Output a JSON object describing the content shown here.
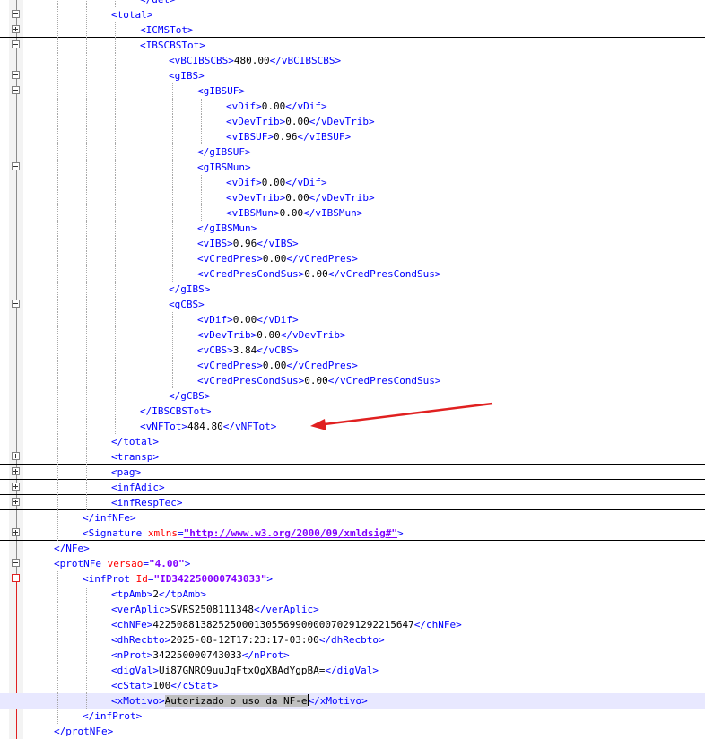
{
  "editor": {
    "colors": {
      "tag": "#0000ff",
      "attribute": "#ff0000",
      "attribute_value": "#8000ff",
      "text": "#000000",
      "annotation_arrow": "#e02020"
    },
    "annotation": {
      "type": "red-arrow",
      "points_to": "vNFTot"
    },
    "lines": [
      {
        "depth": 4,
        "fold": "none",
        "parts": [
          {
            "k": "t",
            "s": "</det>"
          }
        ]
      },
      {
        "depth": 3,
        "fold": "minus",
        "parts": [
          {
            "k": "t",
            "s": "<total>"
          }
        ]
      },
      {
        "depth": 4,
        "fold": "plus",
        "parts": [
          {
            "k": "t",
            "s": "<ICMSTot>"
          }
        ],
        "separator": true
      },
      {
        "depth": 4,
        "fold": "minus",
        "parts": [
          {
            "k": "t",
            "s": "<IBSCBSTot>"
          }
        ]
      },
      {
        "depth": 5,
        "fold": "none",
        "parts": [
          {
            "k": "t",
            "s": "<vBCIBSCBS>"
          },
          {
            "k": "x",
            "s": "480.00"
          },
          {
            "k": "t",
            "s": "</vBCIBSCBS>"
          }
        ]
      },
      {
        "depth": 5,
        "fold": "minus",
        "parts": [
          {
            "k": "t",
            "s": "<gIBS>"
          }
        ]
      },
      {
        "depth": 6,
        "fold": "minus",
        "parts": [
          {
            "k": "t",
            "s": "<gIBSUF>"
          }
        ]
      },
      {
        "depth": 7,
        "fold": "none",
        "parts": [
          {
            "k": "t",
            "s": "<vDif>"
          },
          {
            "k": "x",
            "s": "0.00"
          },
          {
            "k": "t",
            "s": "</vDif>"
          }
        ]
      },
      {
        "depth": 7,
        "fold": "none",
        "parts": [
          {
            "k": "t",
            "s": "<vDevTrib>"
          },
          {
            "k": "x",
            "s": "0.00"
          },
          {
            "k": "t",
            "s": "</vDevTrib>"
          }
        ]
      },
      {
        "depth": 7,
        "fold": "none",
        "parts": [
          {
            "k": "t",
            "s": "<vIBSUF>"
          },
          {
            "k": "x",
            "s": "0.96"
          },
          {
            "k": "t",
            "s": "</vIBSUF>"
          }
        ]
      },
      {
        "depth": 6,
        "fold": "none",
        "parts": [
          {
            "k": "t",
            "s": "</gIBSUF>"
          }
        ]
      },
      {
        "depth": 6,
        "fold": "minus",
        "parts": [
          {
            "k": "t",
            "s": "<gIBSMun>"
          }
        ]
      },
      {
        "depth": 7,
        "fold": "none",
        "parts": [
          {
            "k": "t",
            "s": "<vDif>"
          },
          {
            "k": "x",
            "s": "0.00"
          },
          {
            "k": "t",
            "s": "</vDif>"
          }
        ]
      },
      {
        "depth": 7,
        "fold": "none",
        "parts": [
          {
            "k": "t",
            "s": "<vDevTrib>"
          },
          {
            "k": "x",
            "s": "0.00"
          },
          {
            "k": "t",
            "s": "</vDevTrib>"
          }
        ]
      },
      {
        "depth": 7,
        "fold": "none",
        "parts": [
          {
            "k": "t",
            "s": "<vIBSMun>"
          },
          {
            "k": "x",
            "s": "0.00"
          },
          {
            "k": "t",
            "s": "</vIBSMun>"
          }
        ]
      },
      {
        "depth": 6,
        "fold": "none",
        "parts": [
          {
            "k": "t",
            "s": "</gIBSMun>"
          }
        ]
      },
      {
        "depth": 6,
        "fold": "none",
        "parts": [
          {
            "k": "t",
            "s": "<vIBS>"
          },
          {
            "k": "x",
            "s": "0.96"
          },
          {
            "k": "t",
            "s": "</vIBS>"
          }
        ]
      },
      {
        "depth": 6,
        "fold": "none",
        "parts": [
          {
            "k": "t",
            "s": "<vCredPres>"
          },
          {
            "k": "x",
            "s": "0.00"
          },
          {
            "k": "t",
            "s": "</vCredPres>"
          }
        ]
      },
      {
        "depth": 6,
        "fold": "none",
        "parts": [
          {
            "k": "t",
            "s": "<vCredPresCondSus>"
          },
          {
            "k": "x",
            "s": "0.00"
          },
          {
            "k": "t",
            "s": "</vCredPresCondSus>"
          }
        ]
      },
      {
        "depth": 5,
        "fold": "none",
        "parts": [
          {
            "k": "t",
            "s": "</gIBS>"
          }
        ]
      },
      {
        "depth": 5,
        "fold": "minus",
        "parts": [
          {
            "k": "t",
            "s": "<gCBS>"
          }
        ]
      },
      {
        "depth": 6,
        "fold": "none",
        "parts": [
          {
            "k": "t",
            "s": "<vDif>"
          },
          {
            "k": "x",
            "s": "0.00"
          },
          {
            "k": "t",
            "s": "</vDif>"
          }
        ]
      },
      {
        "depth": 6,
        "fold": "none",
        "parts": [
          {
            "k": "t",
            "s": "<vDevTrib>"
          },
          {
            "k": "x",
            "s": "0.00"
          },
          {
            "k": "t",
            "s": "</vDevTrib>"
          }
        ]
      },
      {
        "depth": 6,
        "fold": "none",
        "parts": [
          {
            "k": "t",
            "s": "<vCBS>"
          },
          {
            "k": "x",
            "s": "3.84"
          },
          {
            "k": "t",
            "s": "</vCBS>"
          }
        ]
      },
      {
        "depth": 6,
        "fold": "none",
        "parts": [
          {
            "k": "t",
            "s": "<vCredPres>"
          },
          {
            "k": "x",
            "s": "0.00"
          },
          {
            "k": "t",
            "s": "</vCredPres>"
          }
        ]
      },
      {
        "depth": 6,
        "fold": "none",
        "parts": [
          {
            "k": "t",
            "s": "<vCredPresCondSus>"
          },
          {
            "k": "x",
            "s": "0.00"
          },
          {
            "k": "t",
            "s": "</vCredPresCondSus>"
          }
        ]
      },
      {
        "depth": 5,
        "fold": "none",
        "parts": [
          {
            "k": "t",
            "s": "</gCBS>"
          }
        ]
      },
      {
        "depth": 4,
        "fold": "none",
        "parts": [
          {
            "k": "t",
            "s": "</IBSCBSTot>"
          }
        ]
      },
      {
        "depth": 4,
        "fold": "none",
        "arrow_target": true,
        "parts": [
          {
            "k": "t",
            "s": "<vNFTot>"
          },
          {
            "k": "x",
            "s": "484.80"
          },
          {
            "k": "t",
            "s": "</vNFTot>"
          }
        ]
      },
      {
        "depth": 3,
        "fold": "none",
        "parts": [
          {
            "k": "t",
            "s": "</total>"
          }
        ]
      },
      {
        "depth": 3,
        "fold": "plus",
        "parts": [
          {
            "k": "t",
            "s": "<transp>"
          }
        ],
        "separator": true
      },
      {
        "depth": 3,
        "fold": "plus",
        "parts": [
          {
            "k": "t",
            "s": "<pag>"
          }
        ],
        "separator": true
      },
      {
        "depth": 3,
        "fold": "plus",
        "parts": [
          {
            "k": "t",
            "s": "<infAdic>"
          }
        ],
        "separator": true
      },
      {
        "depth": 3,
        "fold": "plus",
        "parts": [
          {
            "k": "t",
            "s": "<infRespTec>"
          }
        ],
        "separator": true
      },
      {
        "depth": 2,
        "fold": "none",
        "parts": [
          {
            "k": "t",
            "s": "</infNFe>"
          }
        ]
      },
      {
        "depth": 2,
        "fold": "plus",
        "parts": [
          {
            "k": "t",
            "s": "<Signature "
          },
          {
            "k": "a",
            "s": "xmlns"
          },
          {
            "k": "t",
            "s": "="
          },
          {
            "k": "v",
            "s": "\"http://www.w3.org/2000/09/xmldsig#\"",
            "underline": true
          },
          {
            "k": "t",
            "s": ">"
          }
        ],
        "separator": true
      },
      {
        "depth": 1,
        "fold": "none",
        "parts": [
          {
            "k": "t",
            "s": "</NFe>"
          }
        ]
      },
      {
        "depth": 1,
        "fold": "minus",
        "parts": [
          {
            "k": "t",
            "s": "<protNFe "
          },
          {
            "k": "a",
            "s": "versao"
          },
          {
            "k": "t",
            "s": "="
          },
          {
            "k": "v",
            "s": "\"4.00\""
          },
          {
            "k": "t",
            "s": ">"
          }
        ]
      },
      {
        "depth": 2,
        "fold": "minus-active",
        "parts": [
          {
            "k": "t",
            "s": "<infProt "
          },
          {
            "k": "a",
            "s": "Id"
          },
          {
            "k": "t",
            "s": "="
          },
          {
            "k": "v",
            "s": "\"ID342250000743033\""
          },
          {
            "k": "t",
            "s": ">"
          }
        ]
      },
      {
        "depth": 3,
        "fold": "none",
        "parts": [
          {
            "k": "t",
            "s": "<tpAmb>"
          },
          {
            "k": "x",
            "s": "2"
          },
          {
            "k": "t",
            "s": "</tpAmb>"
          }
        ]
      },
      {
        "depth": 3,
        "fold": "none",
        "parts": [
          {
            "k": "t",
            "s": "<verAplic>"
          },
          {
            "k": "x",
            "s": "SVRS2508111348"
          },
          {
            "k": "t",
            "s": "</verAplic>"
          }
        ]
      },
      {
        "depth": 3,
        "fold": "none",
        "parts": [
          {
            "k": "t",
            "s": "<chNFe>"
          },
          {
            "k": "x",
            "s": "42250881382525000130556990000070291292215647"
          },
          {
            "k": "t",
            "s": "</chNFe>"
          }
        ]
      },
      {
        "depth": 3,
        "fold": "none",
        "parts": [
          {
            "k": "t",
            "s": "<dhRecbto>"
          },
          {
            "k": "x",
            "s": "2025-08-12T17:23:17-03:00"
          },
          {
            "k": "t",
            "s": "</dhRecbto>"
          }
        ]
      },
      {
        "depth": 3,
        "fold": "none",
        "parts": [
          {
            "k": "t",
            "s": "<nProt>"
          },
          {
            "k": "x",
            "s": "342250000743033"
          },
          {
            "k": "t",
            "s": "</nProt>"
          }
        ]
      },
      {
        "depth": 3,
        "fold": "none",
        "parts": [
          {
            "k": "t",
            "s": "<digVal>"
          },
          {
            "k": "x",
            "s": "Ui87GNRQ9uuJqFtxQgXBAdYgpBA="
          },
          {
            "k": "t",
            "s": "</digVal>"
          }
        ]
      },
      {
        "depth": 3,
        "fold": "none",
        "parts": [
          {
            "k": "t",
            "s": "<cStat>"
          },
          {
            "k": "x",
            "s": "100"
          },
          {
            "k": "t",
            "s": "</cStat>"
          }
        ]
      },
      {
        "depth": 3,
        "fold": "none",
        "highlight": true,
        "parts": [
          {
            "k": "t",
            "s": "<xMotivo>"
          },
          {
            "k": "x",
            "s": "Autorizado o uso da NF-e",
            "selected": true,
            "caret": true
          },
          {
            "k": "t",
            "s": "</xMotivo>"
          }
        ]
      },
      {
        "depth": 2,
        "fold": "none",
        "parts": [
          {
            "k": "t",
            "s": "</infProt>"
          }
        ]
      },
      {
        "depth": 1,
        "fold": "none",
        "parts": [
          {
            "k": "t",
            "s": "</protNFe>"
          }
        ]
      }
    ]
  }
}
